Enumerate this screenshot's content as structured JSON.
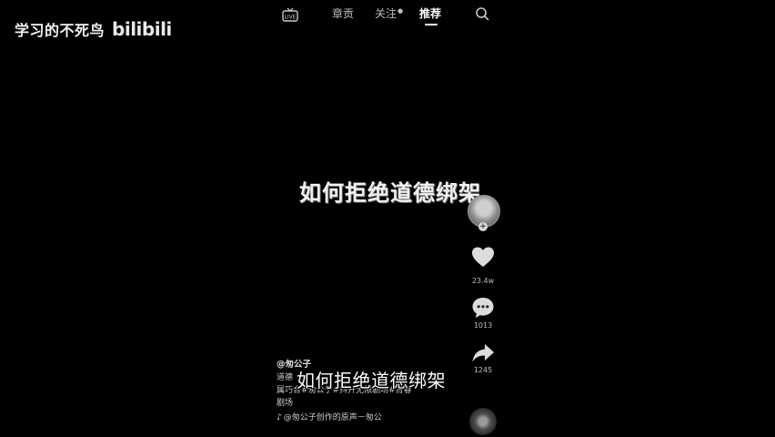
{
  "watermark": {
    "channel_name": "学习的不死鸟",
    "site_logo": "bilibili"
  },
  "top_nav": {
    "tabs": [
      {
        "label": "章贡"
      },
      {
        "label": "关注"
      },
      {
        "label": "推荐",
        "active": true
      }
    ],
    "follow_badge": "●",
    "live_icon": "live-tv-icon",
    "search_icon": "search-icon"
  },
  "video": {
    "title_overlay": "如何拒绝道德绑架",
    "subtitle": "如何拒绝道德绑架"
  },
  "actions": {
    "like_count": "23.4w",
    "comment_count": "1013",
    "share_count": "1245",
    "follow_plus": "+"
  },
  "caption": {
    "author": "@匆公子",
    "desc_line1": "道德",
    "desc_line2": "属巧合#匆公子#抖开无限剧场#青春",
    "desc_line3": "剧场",
    "music": "@匆公子创作的原声－匆公"
  },
  "colors": {
    "background": "#000000",
    "text_primary": "#ffffff",
    "text_secondary": "#bdbdbd"
  }
}
